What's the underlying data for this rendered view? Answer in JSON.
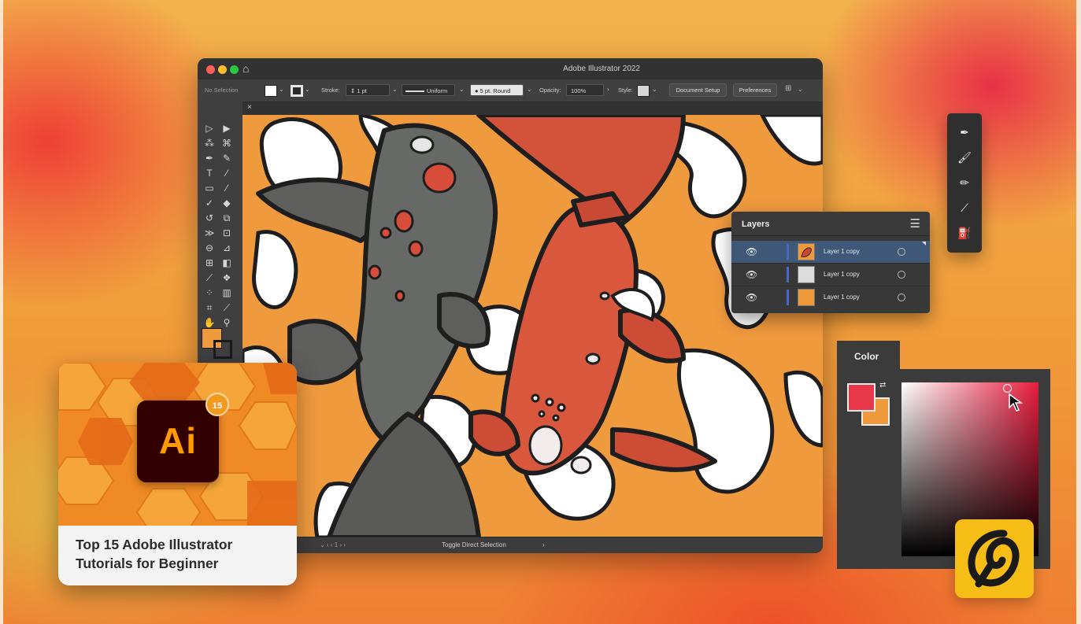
{
  "app": {
    "window_title": "Adobe Illustrator 2022",
    "controlbar": {
      "selection_state": "No Selection",
      "stroke_label": "Stroke:",
      "stroke_weight": "1 pt",
      "profile": "Uniform",
      "brush": "5 pt. Round",
      "opacity_label": "Opacity:",
      "opacity_value": "100%",
      "style_label": "Style:",
      "document_setup": "Document Setup",
      "preferences": "Preferences"
    },
    "status_text": "Toggle Direct Selection",
    "fill_color": "#f09a3e",
    "stroke_color": "#1a1a1a"
  },
  "layers_panel": {
    "title": "Layers",
    "layers": [
      {
        "name": "Layer 1 copy",
        "selected": true,
        "thumb": "fish-art"
      },
      {
        "name": "Layer 1 copy",
        "selected": false,
        "thumb": "#dcdcdc"
      },
      {
        "name": "Layer 1 copy",
        "selected": false,
        "thumb": "#f09a3e"
      }
    ]
  },
  "floating_tools": [
    "pen-icon",
    "brush-icon",
    "pencil-icon",
    "eyedropper-icon",
    "paint-bucket-icon"
  ],
  "color_panel": {
    "title": "Color",
    "fill": "#e8374b",
    "stroke": "#f09a3e",
    "hue": "#e81c3d"
  },
  "course_card": {
    "logo_text": "Ai",
    "badge": "15",
    "title_line1": "Top 15 Adobe Illustrator",
    "title_line2": "Tutorials for Beginner"
  },
  "colors": {
    "accent_orange": "#f09a3e",
    "ui_dark": "#3a3a3a",
    "brand_yellow": "#f6bd16"
  }
}
